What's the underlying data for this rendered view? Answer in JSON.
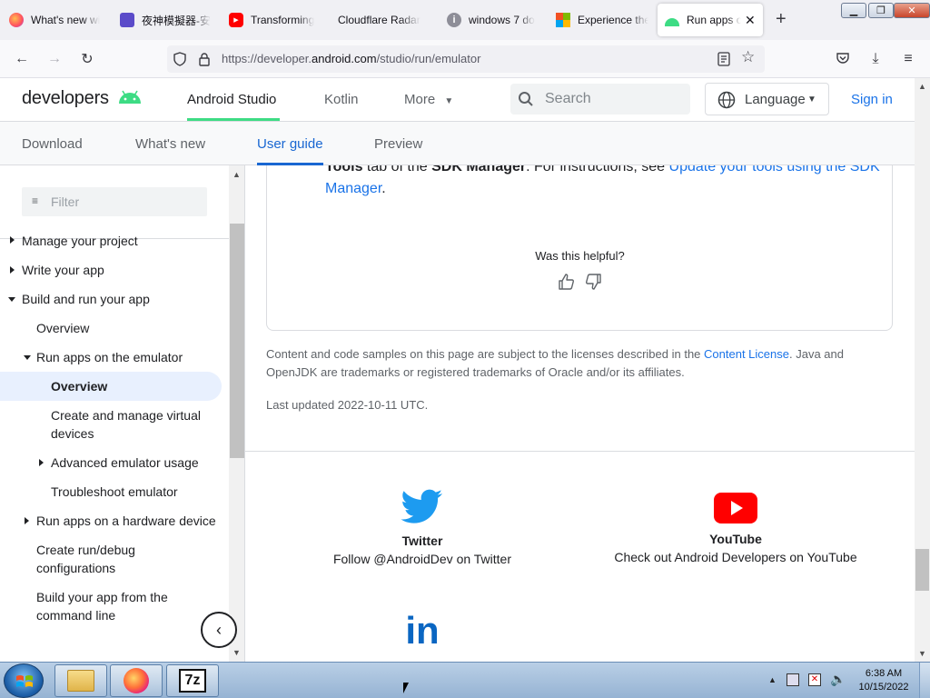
{
  "browser": {
    "tabs": [
      {
        "label": "What's new wi",
        "icon": "firefox-icon",
        "active": false
      },
      {
        "label": "夜神模擬器-安",
        "icon": "nox-icon",
        "active": false
      },
      {
        "label": "Transforming",
        "icon": "youtube-icon",
        "active": false
      },
      {
        "label": "Cloudflare Radar",
        "icon": "cloudflare-icon",
        "active": false
      },
      {
        "label": "windows 7 do",
        "icon": "info-icon",
        "active": false
      },
      {
        "label": "Experience the",
        "icon": "microsoft-icon",
        "active": false
      },
      {
        "label": "Run apps on",
        "icon": "android-icon",
        "active": true
      }
    ],
    "new_tab": "+",
    "url": {
      "prefix": "https://developer.",
      "domain": "android.com",
      "path": "/studio/run/emulator"
    }
  },
  "site": {
    "logo_text": "developers",
    "topnav": [
      "Android Studio",
      "Kotlin",
      "More"
    ],
    "search_placeholder": "Search",
    "language": "Language",
    "signin": "Sign in",
    "subnav": [
      "Download",
      "What's new",
      "User guide",
      "Preview"
    ],
    "accent_green": "#3ddc84",
    "link_blue": "#1a73e8"
  },
  "sidebar": {
    "filter_placeholder": "Filter",
    "items": [
      {
        "label": "Manage your project"
      },
      {
        "label": "Write your app"
      },
      {
        "label": "Build and run your app"
      },
      {
        "label": "Overview"
      },
      {
        "label": "Run apps on the emulator"
      },
      {
        "label": "Overview",
        "selected": true
      },
      {
        "label": "Create and manage virtual devices"
      },
      {
        "label": "Advanced emulator usage"
      },
      {
        "label": "Troubleshoot emulator"
      },
      {
        "label": "Run apps on a hardware device"
      },
      {
        "label": "Create run/debug configurations"
      },
      {
        "label": "Build your app from the command line"
      }
    ]
  },
  "article": {
    "para": {
      "b1": "Tools",
      "t1": " tab of the ",
      "b2": "SDK Manager",
      "t2": ". For instructions, see ",
      "link": "Update your tools using the SDK Manager",
      "t3": "."
    },
    "helpful": "Was this helpful?",
    "license": {
      "t1": "Content and code samples on this page are subject to the licenses described in the ",
      "link": "Content License",
      "t2": ". Java and OpenJDK are trademarks or registered trademarks of Oracle and/or its affiliates."
    },
    "updated": "Last updated 2022-10-11 UTC."
  },
  "footer": {
    "social": [
      {
        "name": "Twitter",
        "desc": "Follow @AndroidDev on Twitter",
        "icon": "twitter-icon"
      },
      {
        "name": "YouTube",
        "desc": "Check out Android Developers on YouTube",
        "icon": "youtube-icon"
      },
      {
        "name": "LinkedIn",
        "icon": "linkedin-icon"
      }
    ]
  },
  "taskbar": {
    "time": "6:38 AM",
    "date": "10/15/2022",
    "apps": [
      "file-explorer-icon",
      "firefox-icon",
      "7zip-icon"
    ],
    "sevenzip_label": "7z"
  }
}
